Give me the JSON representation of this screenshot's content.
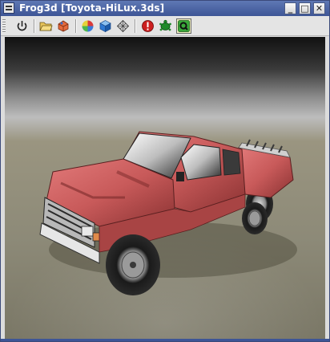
{
  "window": {
    "title": "Frog3d [Toyota-HiLux.3ds]",
    "controls": {
      "minimize": "_",
      "maximize": "□",
      "close": "✕"
    }
  },
  "toolbar": {
    "buttons": [
      {
        "name": "power-button",
        "icon": "power-icon"
      },
      {
        "name": "open-button",
        "icon": "folder-icon"
      },
      {
        "name": "load-model-button",
        "icon": "model-icon"
      },
      {
        "name": "color-button",
        "icon": "color-wheel-icon"
      },
      {
        "name": "cube-button",
        "icon": "cube-icon"
      },
      {
        "name": "wireframe-button",
        "icon": "wireframe-icon"
      },
      {
        "name": "stop-button",
        "icon": "stop-icon"
      },
      {
        "name": "turtle-button",
        "icon": "turtle-icon"
      },
      {
        "name": "qt-button",
        "icon": "qt-icon",
        "active": true
      }
    ]
  },
  "viewport": {
    "model": "Toyota-HiLux.3ds"
  },
  "colors": {
    "titlebar": "#3d5596",
    "truck_body": "#c85a5a",
    "floor": "#8d8a78"
  }
}
